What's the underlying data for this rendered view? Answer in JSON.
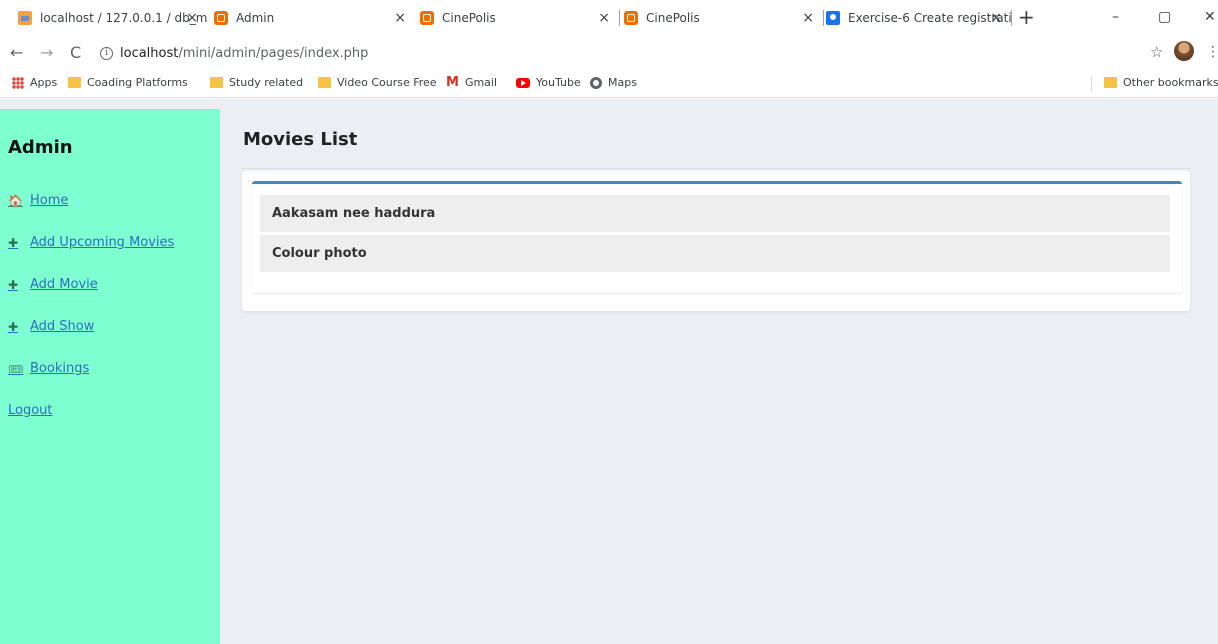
{
  "browser": {
    "tabs": [
      {
        "title": "localhost / 127.0.0.1 / db_m",
        "favicon": "phpmyadmin-icon",
        "active": false
      },
      {
        "title": "Admin",
        "favicon": "cinepolis-icon",
        "active": true
      },
      {
        "title": "CinePolis",
        "favicon": "cinepolis-icon",
        "active": false
      },
      {
        "title": "CinePolis",
        "favicon": "cinepolis-icon",
        "active": false
      },
      {
        "title": "Exercise-6 Create registrati",
        "favicon": "form-icon",
        "active": false
      }
    ],
    "new_tab": "+",
    "close_glyph": "×",
    "window_controls": {
      "minimize": "–",
      "maximize": "▢",
      "close": "✕"
    },
    "address": {
      "info_glyph": "i",
      "url_host": "localhost",
      "url_path": "/mini/admin/pages/index.php"
    },
    "nav_glyphs": {
      "back": "←",
      "forward": "→",
      "reload": "C"
    },
    "star_glyph": "☆",
    "menu_glyph": "⋮",
    "bookmarks": [
      {
        "label": "Apps",
        "icon": "apps-icon"
      },
      {
        "label": "Coading Platforms",
        "icon": "folder-icon"
      },
      {
        "label": "Study related",
        "icon": "folder-icon"
      },
      {
        "label": "Video Course Free",
        "icon": "folder-icon"
      },
      {
        "label": "Gmail",
        "icon": "gmail-icon"
      },
      {
        "label": "YouTube",
        "icon": "youtube-icon"
      },
      {
        "label": "Maps",
        "icon": "maps-icon"
      }
    ],
    "other_bookmarks": "Other bookmarks",
    "gmail_glyph": "M"
  },
  "sidebar": {
    "brand": "Admin",
    "items": [
      {
        "label": "Home",
        "icon": "home-icon",
        "glyph": "🏠"
      },
      {
        "label": "Add Upcoming Movies",
        "icon": "plus-icon",
        "glyph": "✚"
      },
      {
        "label": "Add Movie",
        "icon": "plus-icon",
        "glyph": "✚"
      },
      {
        "label": "Add Show",
        "icon": "plus-icon",
        "glyph": "✚"
      },
      {
        "label": "Bookings",
        "icon": "ticket-icon",
        "glyph": "🎟"
      },
      {
        "label": "Logout",
        "icon": "",
        "glyph": ""
      }
    ]
  },
  "main": {
    "title": "Movies List",
    "movies": [
      "Aakasam nee haddura",
      "Colour photo"
    ]
  },
  "colors": {
    "sidebar_bg": "#7effd1",
    "page_bg": "#ebeef3",
    "box_accent": "#4a85b5",
    "link": "#2e6fb8"
  }
}
